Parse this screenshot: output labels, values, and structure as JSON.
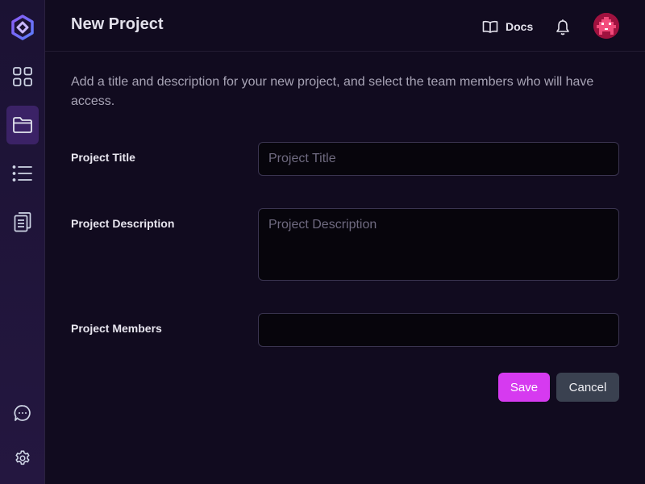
{
  "header": {
    "title": "New Project",
    "docs_label": "Docs"
  },
  "sidebar": {
    "items": [
      {
        "name": "dashboard",
        "icon": "grid-icon",
        "active": false
      },
      {
        "name": "projects",
        "icon": "folder-icon",
        "active": true
      },
      {
        "name": "list",
        "icon": "list-icon",
        "active": false
      },
      {
        "name": "documents",
        "icon": "documents-icon",
        "active": false
      },
      {
        "name": "chat",
        "icon": "chat-bubble-icon",
        "active": false
      },
      {
        "name": "settings",
        "icon": "gear-icon",
        "active": false
      }
    ]
  },
  "form": {
    "intro": "Add a title and description for your new project, and select the team members who will have access.",
    "title_label": "Project Title",
    "title_placeholder": "Project Title",
    "title_value": "",
    "description_label": "Project Description",
    "description_placeholder": "Project Description",
    "description_value": "",
    "members_label": "Project Members",
    "members_value": "",
    "save_label": "Save",
    "cancel_label": "Cancel"
  },
  "colors": {
    "background": "#110b1f",
    "sidebar": "#1b1233",
    "active_nav": "#3b2266",
    "save_button": "#d63af0",
    "cancel_button": "#3a4150",
    "logo_accent": "#8b5cf6"
  }
}
